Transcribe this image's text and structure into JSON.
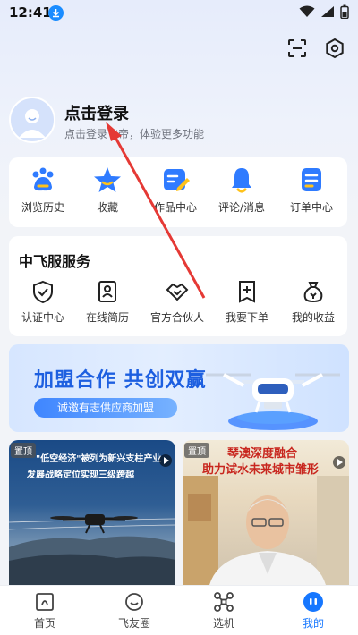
{
  "status_bar": {
    "time": "12:41"
  },
  "header": {
    "scan_icon": "scan-icon",
    "settings_icon": "settings-icon"
  },
  "profile": {
    "title": "点击登录",
    "subtitle": "点击登录飞帝，体验更多功能"
  },
  "quick_links": [
    {
      "label": "浏览历史",
      "icon": "paw-icon"
    },
    {
      "label": "收藏",
      "icon": "star-icon"
    },
    {
      "label": "作品中心",
      "icon": "edit-icon"
    },
    {
      "label": "评论/消息",
      "icon": "bell-icon"
    },
    {
      "label": "订单中心",
      "icon": "order-icon"
    }
  ],
  "services": {
    "title": "中飞服服务",
    "items": [
      {
        "label": "认证中心",
        "icon": "shield-check-icon"
      },
      {
        "label": "在线简历",
        "icon": "resume-icon"
      },
      {
        "label": "官方合伙人",
        "icon": "handshake-icon"
      },
      {
        "label": "我要下单",
        "icon": "add-order-icon"
      },
      {
        "label": "我的收益",
        "icon": "money-bag-icon"
      }
    ]
  },
  "banner": {
    "title": "加盟合作 共创双赢",
    "button": "诚邀有志供应商加盟"
  },
  "news": [
    {
      "tag": "置顶",
      "line1": "\"低空经济\"被列为新兴支柱产业",
      "line2": "发展战略定位实现三级跨越"
    },
    {
      "tag": "置顶",
      "line1": "琴澳深度融合",
      "line2": "助力试水未来城市雏形"
    }
  ],
  "tabbar": [
    {
      "label": "首页",
      "icon": "home-icon",
      "active": false
    },
    {
      "label": "飞友圈",
      "icon": "chat-icon",
      "active": false
    },
    {
      "label": "选机",
      "icon": "drone-icon",
      "active": false
    },
    {
      "label": "我的",
      "icon": "profile-icon",
      "active": true
    }
  ],
  "colors": {
    "accent": "#1677ff",
    "annotation_arrow": "#e53935"
  }
}
